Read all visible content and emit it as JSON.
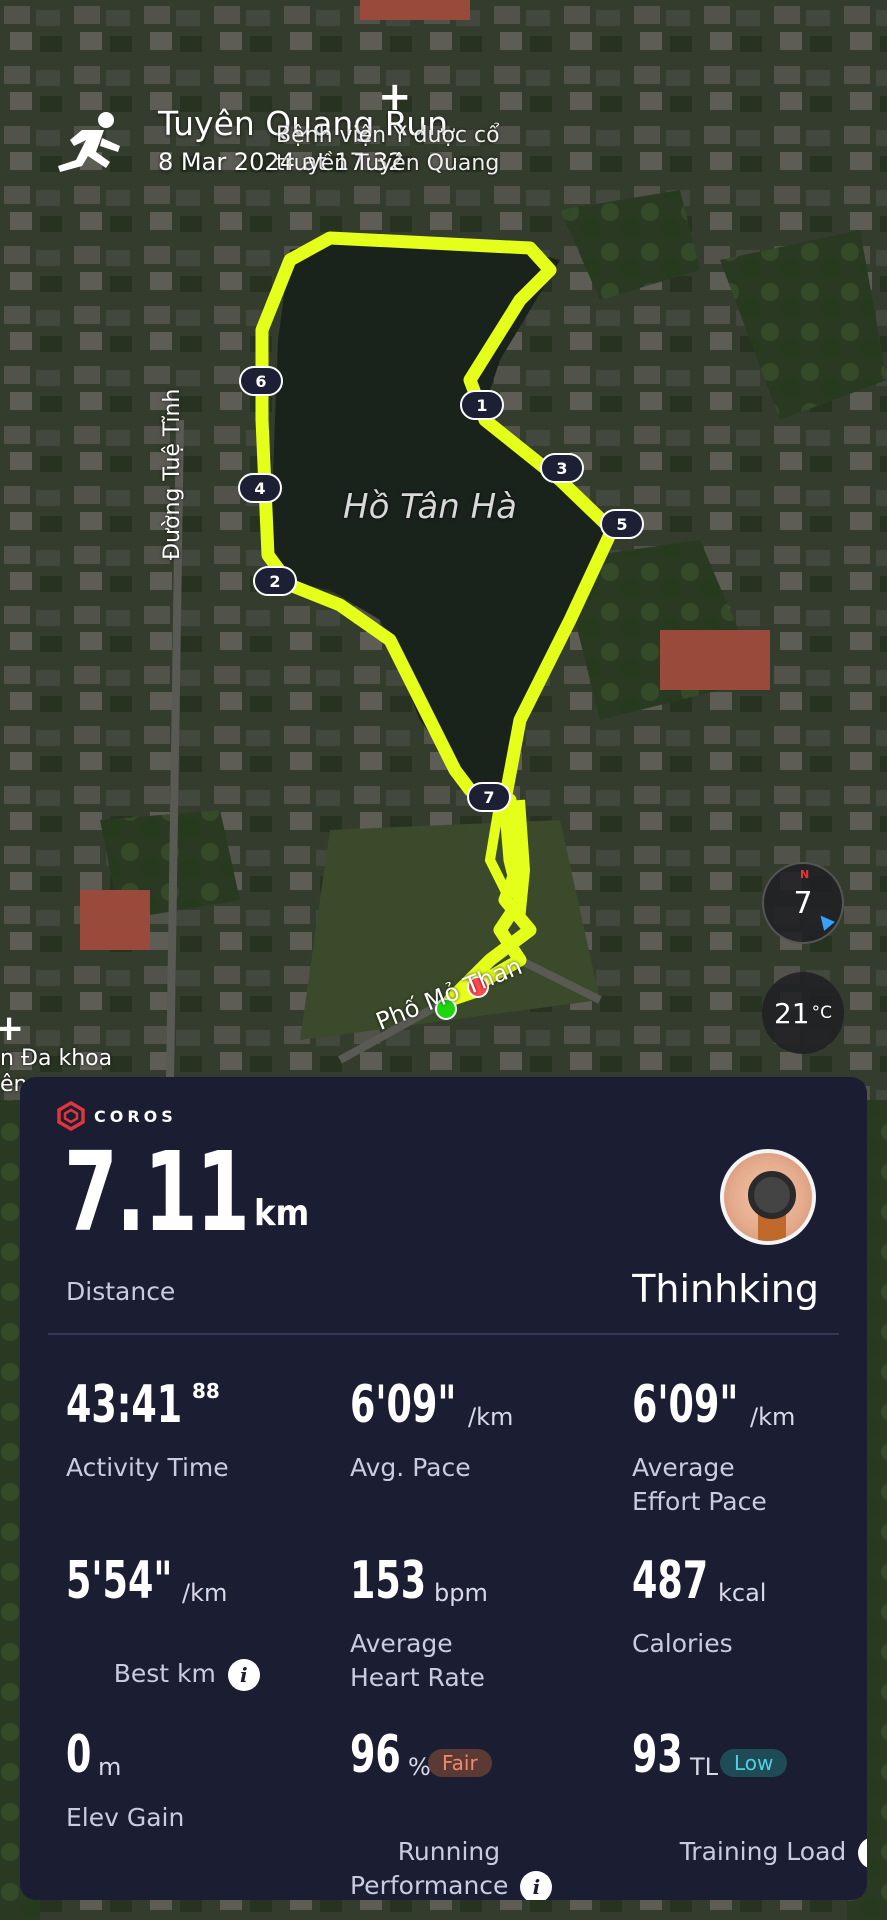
{
  "header": {
    "title": "Tuyên Quang Run",
    "datetime": "8 Mar 2024 at 17:32",
    "activity_icon": "running-person-icon"
  },
  "map": {
    "labels": {
      "hospital": "Bệnh viện Y dược cổ truyền Tuyên Quang",
      "lake": "Hồ Tân Hà",
      "road_west": "Đường Tuệ Tĩnh",
      "road_south": "Phố Mỏ Than",
      "clinic": "n Đa khoa\nên"
    },
    "km_markers": [
      "1",
      "2",
      "3",
      "4",
      "5",
      "6",
      "7"
    ],
    "route_color": "#e4ff1a",
    "start_color": "#1fd60e",
    "end_color": "#ff4b4b",
    "compass_value": "7",
    "compass_north": "N",
    "temperature": "21",
    "temperature_unit": "°C"
  },
  "card": {
    "brand": "COROS",
    "distance": {
      "value": "7.11",
      "unit": "km",
      "label": "Distance"
    },
    "user": {
      "name": "Thinhking"
    },
    "stats": {
      "activity_time": {
        "value": "43:41",
        "sup": "88",
        "label": "Activity Time"
      },
      "avg_pace": {
        "value": "6'09\"",
        "unit": "/km",
        "label": "Avg. Pace"
      },
      "effort_pace": {
        "value": "6'09\"",
        "unit": "/km",
        "label": "Average\nEffort Pace"
      },
      "best_km": {
        "value": "5'54\"",
        "unit": "/km",
        "label": "Best km"
      },
      "heart_rate": {
        "value": "153",
        "unit": "bpm",
        "label": "Average\nHeart Rate"
      },
      "calories": {
        "value": "487",
        "unit": "kcal",
        "label": "Calories"
      },
      "elev_gain": {
        "value": "0",
        "unit": "m",
        "label": "Elev Gain"
      },
      "running_performance": {
        "value": "96",
        "unit": "%",
        "badge": "Fair",
        "label": "Running\nPerformance"
      },
      "training_load": {
        "value": "93",
        "unit": "TL",
        "badge": "Low",
        "label": "Training Load"
      }
    },
    "colors": {
      "background": "#1b1d33",
      "fair_badge_bg": "#5b3a36",
      "fair_badge_text": "#f08a6a",
      "low_badge_bg": "#1f4b57",
      "low_badge_text": "#52d0e0"
    }
  }
}
